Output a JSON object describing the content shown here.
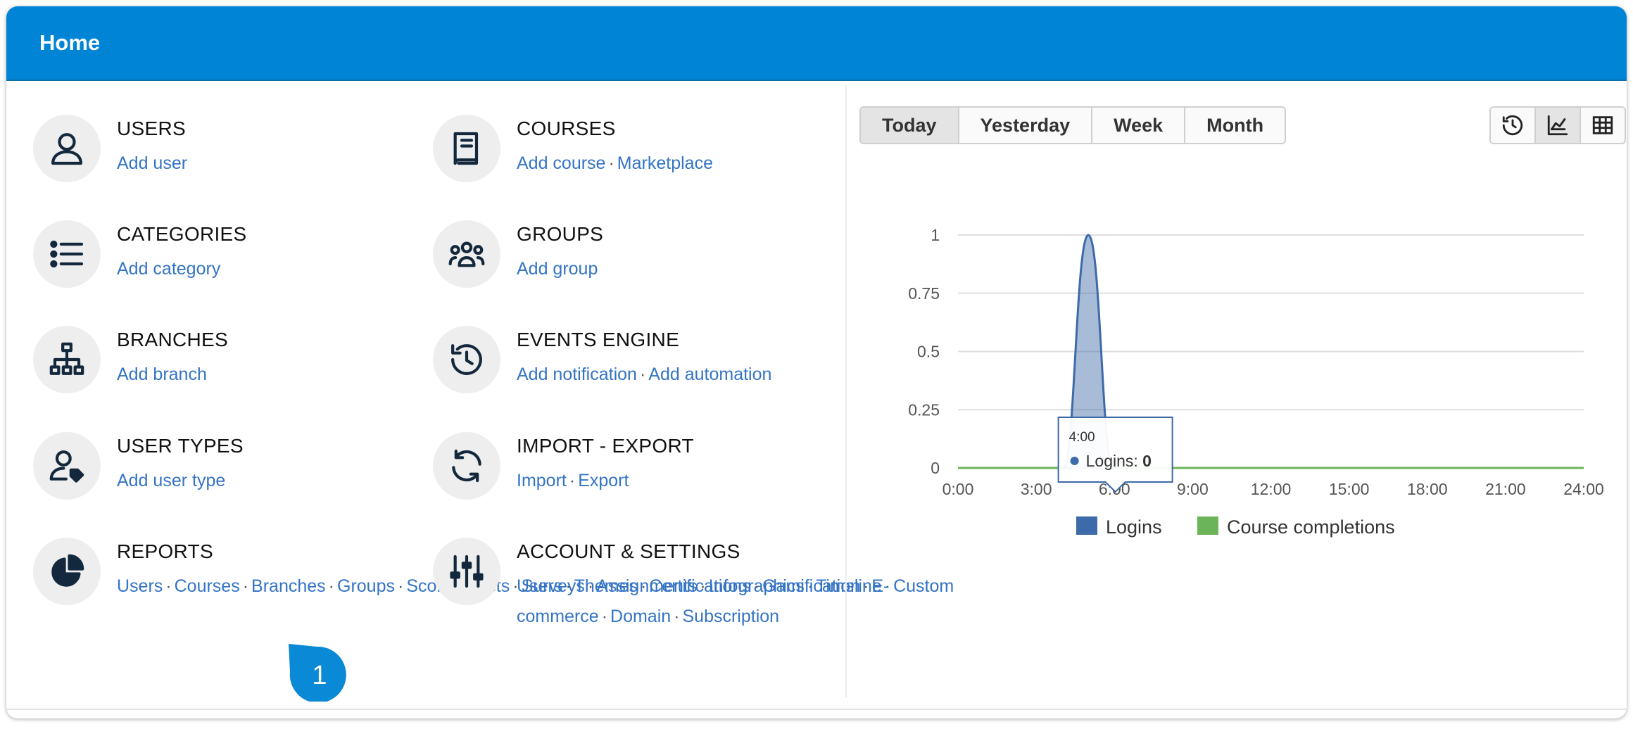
{
  "header": {
    "title": "Home"
  },
  "tiles": [
    {
      "key": "users",
      "title": "USERS",
      "icon": "user-icon",
      "links": [
        "Add user"
      ]
    },
    {
      "key": "courses",
      "title": "COURSES",
      "icon": "book-icon",
      "links": [
        "Add course",
        "Marketplace"
      ]
    },
    {
      "key": "categories",
      "title": "CATEGORIES",
      "icon": "list-icon",
      "links": [
        "Add category"
      ]
    },
    {
      "key": "groups",
      "title": "GROUPS",
      "icon": "groups-icon",
      "links": [
        "Add group"
      ]
    },
    {
      "key": "branches",
      "title": "BRANCHES",
      "icon": "sitemap-icon",
      "links": [
        "Add branch"
      ]
    },
    {
      "key": "events",
      "title": "EVENTS ENGINE",
      "icon": "history-icon",
      "links": [
        "Add notification",
        "Add automation"
      ]
    },
    {
      "key": "usertypes",
      "title": "USER TYPES",
      "icon": "user-tag-icon",
      "links": [
        "Add user type"
      ]
    },
    {
      "key": "importexport",
      "title": "IMPORT - EXPORT",
      "icon": "sync-icon",
      "links": [
        "Import",
        "Export"
      ]
    },
    {
      "key": "reports",
      "title": "REPORTS",
      "icon": "pie-chart-icon",
      "links": [
        "Users",
        "Courses",
        "Branches",
        "Groups",
        "Scorm",
        "Tests",
        "Surveys",
        "Assignments",
        "Infographics",
        "Timeline",
        "Custom"
      ]
    },
    {
      "key": "account",
      "title": "ACCOUNT & SETTINGS",
      "icon": "sliders-icon",
      "links": [
        "Users",
        "Themes",
        "Certifications",
        "Gamification",
        "E-commerce",
        "Domain",
        "Subscription"
      ]
    }
  ],
  "period_buttons": [
    {
      "label": "Today",
      "active": true
    },
    {
      "label": "Yesterday",
      "active": false
    },
    {
      "label": "Week",
      "active": false
    },
    {
      "label": "Month",
      "active": false
    }
  ],
  "view_buttons": [
    {
      "icon": "history-icon",
      "active": false
    },
    {
      "icon": "area-chart-icon",
      "active": true
    },
    {
      "icon": "table-icon",
      "active": false
    }
  ],
  "callout": {
    "label": "1"
  },
  "chart_data": {
    "type": "area",
    "x": [
      "0:00",
      "1:00",
      "2:00",
      "3:00",
      "4:00",
      "5:00",
      "6:00",
      "7:00",
      "8:00",
      "9:00",
      "10:00",
      "11:00",
      "12:00",
      "13:00",
      "14:00",
      "15:00",
      "16:00",
      "17:00",
      "18:00",
      "19:00",
      "20:00",
      "21:00",
      "22:00",
      "23:00"
    ],
    "x_ticks": [
      "0:00",
      "3:00",
      "6:00",
      "9:00",
      "12:00",
      "15:00",
      "18:00",
      "21:00",
      "24:00"
    ],
    "y_ticks": [
      "0",
      "0.25",
      "0.5",
      "0.75",
      "1"
    ],
    "ylim": [
      0,
      1
    ],
    "grid": true,
    "legend_position": "bottom-center",
    "series": [
      {
        "name": "Logins",
        "color": "#3d6aa8",
        "values": [
          0,
          0,
          0,
          0,
          0,
          1,
          0,
          0,
          0,
          0,
          0,
          0,
          0,
          0,
          0,
          0,
          0,
          0,
          0,
          0,
          0,
          0,
          0,
          0
        ]
      },
      {
        "name": "Course completions",
        "color": "#6cb45a",
        "values": [
          0,
          0,
          0,
          0,
          0,
          0,
          0,
          0,
          0,
          0,
          0,
          0,
          0,
          0,
          0,
          0,
          0,
          0,
          0,
          0,
          0,
          0,
          0,
          0
        ]
      }
    ],
    "tooltip": {
      "title": "4:00",
      "series": "Logins",
      "label": "Logins: ",
      "value": "0"
    }
  }
}
